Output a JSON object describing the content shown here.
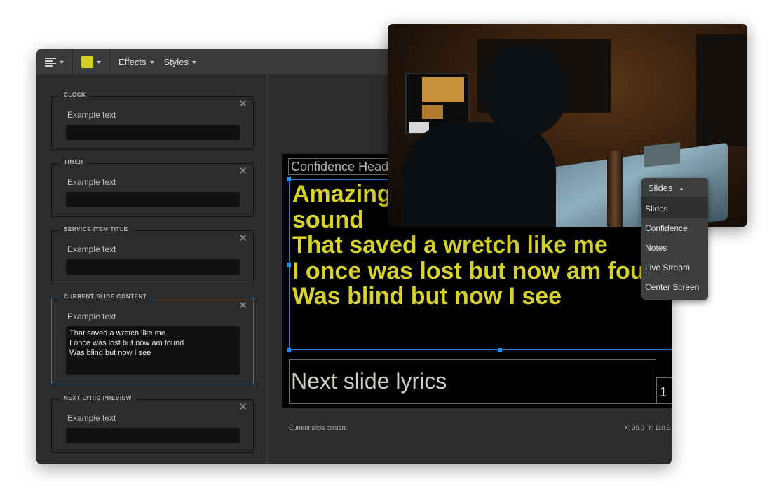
{
  "toolbar": {
    "align_icon": "align-left-icon",
    "color_swatch": "#d4cf2a",
    "menus": [
      {
        "label": "Effects"
      },
      {
        "label": "Styles"
      }
    ]
  },
  "fields": [
    {
      "legend": "CLOCK",
      "label": "Example text",
      "value": "",
      "active": false
    },
    {
      "legend": "TIMER",
      "label": "Example text",
      "value": "",
      "active": false
    },
    {
      "legend": "SERVICE ITEM TITLE",
      "label": "Example text",
      "value": "",
      "active": false
    },
    {
      "legend": "CURRENT SLIDE CONTENT",
      "label": "Example text",
      "value": "That saved a wretch like me\nI once was lost but now am found\nWas blind but now I see",
      "active": true
    },
    {
      "legend": "NEXT LYRIC PREVIEW",
      "label": "Example text",
      "value": "",
      "active": false
    }
  ],
  "canvas": {
    "confidence_header": "Confidence Header",
    "slide_lines": "Amazing grace how sweet the\nsound\nThat saved a wretch like me\nI once was lost but now am found\nWas blind but now I see",
    "next_slide": "Next slide lyrics",
    "counter": "1",
    "lyric_color": "#d7d22a",
    "selection_color": "#1e7fd0"
  },
  "status": {
    "selected_element": "Current slide content",
    "coordinates": "X: 30.0  Y: 110.0"
  },
  "dropdown": {
    "current": "Slides",
    "options": [
      "Slides",
      "Confidence",
      "Notes",
      "Live Stream",
      "Center Screen"
    ],
    "selected_index": 0
  },
  "photo": {
    "description": "Sound engineer at a mixing console in a dimly lit production booth"
  }
}
